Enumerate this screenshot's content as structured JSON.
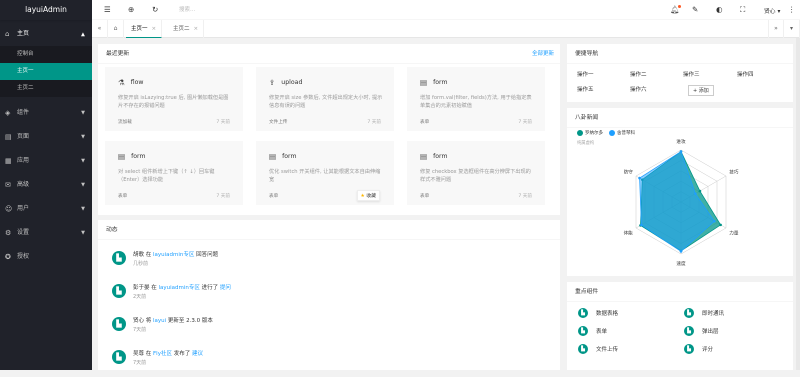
{
  "sidebar": {
    "logo": "layuiAdmin",
    "items": [
      {
        "label": "主页",
        "icon": "home-icon"
      },
      {
        "label": "组件",
        "icon": "component-icon"
      },
      {
        "label": "页面",
        "icon": "template-icon"
      },
      {
        "label": "应用",
        "icon": "app-icon"
      },
      {
        "label": "高级",
        "icon": "senior-icon"
      },
      {
        "label": "用户",
        "icon": "user-icon"
      },
      {
        "label": "设置",
        "icon": "set-icon"
      },
      {
        "label": "授权",
        "icon": "auth-icon"
      }
    ],
    "subitems": [
      "控制台",
      "主页一",
      "主页二"
    ]
  },
  "header": {
    "search_placeholder": "搜索...",
    "user": "贤心"
  },
  "tabs": {
    "items": [
      "主页一",
      "主页二"
    ]
  },
  "updates": {
    "title": "最近更新",
    "more": "全部更新",
    "cards": [
      {
        "title": "flow",
        "icon": "experiment-icon",
        "desc": "修复开启 isLazying:true 后, 图片懒加载但是图片不存在的报错问题",
        "tag": "流加载",
        "time": "7 天前"
      },
      {
        "title": "upload",
        "icon": "upload-icon",
        "desc": "修复开启 size 参数后, 文件超出规定大小时, 提示信息有误的问题",
        "tag": "文件上传",
        "time": "7 天前"
      },
      {
        "title": "form",
        "icon": "form-icon",
        "desc": "增加 form.val(filter, fields)方法, 用于给指定表单集合的元素初始赋值",
        "tag": "表单",
        "time": "7 天前"
      },
      {
        "title": "form",
        "icon": "form-icon",
        "desc": "对 select 组件新增上下键（↑ ↓）回车键（Enter）选择功能",
        "tag": "表单",
        "time": "7 天前"
      },
      {
        "title": "form",
        "icon": "form-icon",
        "desc": "优化 switch 开关组件, 让其能根据文本自由伸缩宽",
        "tag": "表单",
        "time": "7 天前",
        "favorite": "收藏"
      },
      {
        "title": "form",
        "icon": "form-icon",
        "desc": "修复 checkbox 复选框组件在高分辨屏下出现的样式不雅问题",
        "tag": "表单",
        "time": "7 天前"
      }
    ]
  },
  "activity": {
    "title": "动态",
    "items": [
      {
        "user": "胡歌",
        "mid": " 在 ",
        "link": "layuiadmin专区",
        "rest": " 回答问题",
        "time": "几秒前"
      },
      {
        "user": "彭于晏",
        "mid": " 在 ",
        "link": "layuiadmin专区",
        "rest": " 进行了 ",
        "link2": "提问",
        "time": "2天前"
      },
      {
        "user": "贤心",
        "mid": " 将 ",
        "link": "layui",
        "rest": " 更新至 2.3.0 版本",
        "time": "7天前"
      },
      {
        "user": "吴尊",
        "mid": " 在 ",
        "link": "Fly社区",
        "rest": " 发布了 ",
        "link2": "建议",
        "time": "7天前"
      }
    ]
  },
  "quick": {
    "title": "便捷导航",
    "items": [
      "操作一",
      "操作二",
      "操作三",
      "操作四",
      "操作五",
      "操作六"
    ],
    "add": "+ 添加"
  },
  "radar": {
    "title": "八卦新闻",
    "legend": [
      "罗纳尔多",
      "舍普琴科"
    ],
    "subtitle": "纯属虚构",
    "colors": [
      "#009688",
      "#1e9fff"
    ]
  },
  "chart_data": {
    "type": "radar",
    "axes": [
      "进攻",
      "技巧",
      "力量",
      "速度",
      "体能",
      "防守"
    ],
    "max": 100,
    "series": [
      {
        "name": "罗纳尔多",
        "values": [
          97,
          42,
          88,
          94,
          90,
          86
        ]
      },
      {
        "name": "舍普琴科",
        "values": [
          97,
          32,
          74,
          95,
          88,
          92
        ]
      }
    ]
  },
  "components": {
    "title": "重点组件",
    "items": [
      "数据表格",
      "即时通讯",
      "表单",
      "弹出层",
      "文件上传",
      "评分"
    ]
  }
}
